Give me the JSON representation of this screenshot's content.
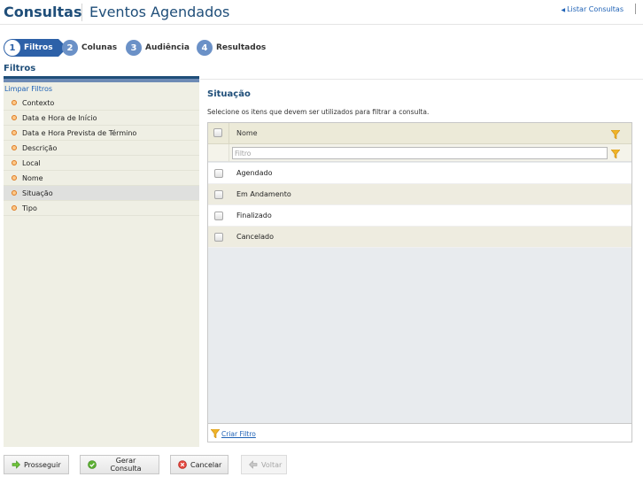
{
  "header": {
    "title": "Consultas",
    "subtitle": "Eventos Agendados",
    "list_link": "Listar Consultas"
  },
  "steps": [
    {
      "num": "1",
      "label": "Filtros",
      "active": true
    },
    {
      "num": "2",
      "label": "Colunas",
      "active": false
    },
    {
      "num": "3",
      "label": "Audiência",
      "active": false
    },
    {
      "num": "4",
      "label": "Resultados",
      "active": false
    }
  ],
  "section": {
    "title": "Filtros"
  },
  "sidebar": {
    "clear_link": "Limpar Filtros",
    "items": [
      {
        "label": "Contexto",
        "selected": false
      },
      {
        "label": "Data e Hora de Início",
        "selected": false
      },
      {
        "label": "Data e Hora Prevista de Término",
        "selected": false
      },
      {
        "label": "Descrição",
        "selected": false
      },
      {
        "label": "Local",
        "selected": false
      },
      {
        "label": "Nome",
        "selected": false
      },
      {
        "label": "Situação",
        "selected": true
      },
      {
        "label": "Tipo",
        "selected": false
      }
    ]
  },
  "main": {
    "title": "Situação",
    "description": "Selecione os itens que devem ser utilizados para filtrar a consulta.",
    "grid": {
      "column_header": "Nome",
      "filter_placeholder": "Filtro",
      "rows": [
        "Agendado",
        "Em Andamento",
        "Finalizado",
        "Cancelado"
      ],
      "create_filter": "Criar Filtro"
    }
  },
  "footer": {
    "continue": "Prosseguir",
    "generate": "Gerar Consulta",
    "cancel": "Cancelar",
    "back": "Voltar"
  },
  "colors": {
    "brand": "#1f4e79",
    "step_active": "#2d61a8",
    "step_inactive": "#6b91c7",
    "link": "#1f62b6",
    "accent_orange": "#e07a1f"
  }
}
